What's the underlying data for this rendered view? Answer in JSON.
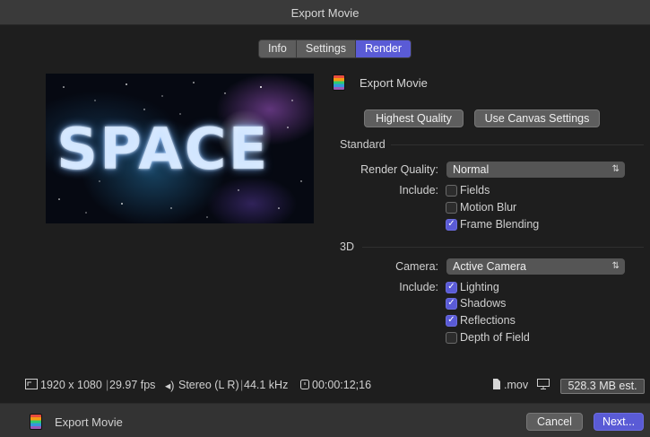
{
  "window": {
    "title": "Export Movie"
  },
  "tabs": [
    {
      "label": "Info",
      "active": false
    },
    {
      "label": "Settings",
      "active": false
    },
    {
      "label": "Render",
      "active": true
    }
  ],
  "preview": {
    "text": "SPACE"
  },
  "header": {
    "title": "Export Movie",
    "icon": "film-strip-icon"
  },
  "buttons": {
    "highest_quality": "Highest Quality",
    "use_canvas": "Use Canvas Settings"
  },
  "standard": {
    "title": "Standard",
    "render_quality_label": "Render Quality:",
    "render_quality_value": "Normal",
    "include_label": "Include:",
    "options": [
      {
        "label": "Fields",
        "checked": false
      },
      {
        "label": "Motion Blur",
        "checked": false
      },
      {
        "label": "Frame Blending",
        "checked": true
      }
    ]
  },
  "three_d": {
    "title": "3D",
    "camera_label": "Camera:",
    "camera_value": "Active Camera",
    "include_label": "Include:",
    "options": [
      {
        "label": "Lighting",
        "checked": true
      },
      {
        "label": "Shadows",
        "checked": true
      },
      {
        "label": "Reflections",
        "checked": true
      },
      {
        "label": "Depth of Field",
        "checked": false
      }
    ]
  },
  "info": {
    "resolution": "1920 x 1080",
    "fps": "29.97 fps",
    "audio": "Stereo (L R)",
    "sample_rate": "44.1 kHz",
    "duration": "00:00:12;16",
    "extension": ".mov",
    "estimate": "528.3 MB est."
  },
  "footer": {
    "title": "Export Movie",
    "cancel": "Cancel",
    "next": "Next..."
  },
  "colors": {
    "accent": "#5a5bd6",
    "background": "#1e1e1e"
  }
}
